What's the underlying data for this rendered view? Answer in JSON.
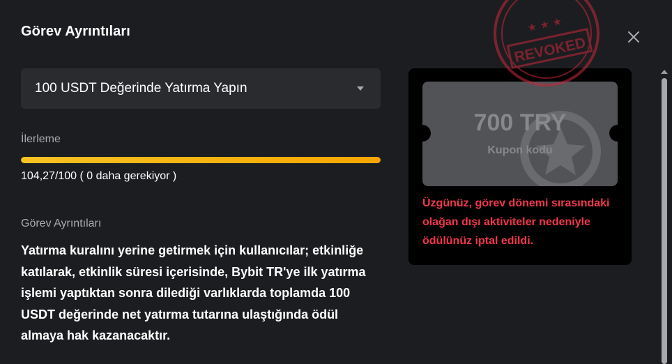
{
  "modal": {
    "title": "Görev Ayrıntıları",
    "close_icon": "close-icon"
  },
  "task_select": {
    "value": "100 USDT Değerinde Yatırma Yapın",
    "icon": "chevron-down-icon"
  },
  "progress": {
    "label": "İlerleme",
    "text": "104,27/100 ( 0 daha gerekiyor )",
    "percent": 100,
    "color": "#f7a600"
  },
  "details": {
    "heading": "Görev Ayrıntıları",
    "body": "Yatırma kuralını yerine getirmek için kullanıcılar; etkinliğe katılarak, etkinlik süresi içerisinde, Bybit TR'ye ilk yatırma işlemi yaptıktan sonra dilediği varlıklarda toplamda 100 USDT değerinde net yatırma tutarına ulaştığında ödül almaya hak kazanacaktır."
  },
  "reward": {
    "amount": "700 TRY",
    "label": "Kupon kodu",
    "watermark_icon": "star-medal-icon",
    "message": "Üzgünüz, görev dönemi sırasındaki olağan dışı aktiviteler nedeniyle ödülünüz iptal edildi.",
    "message_color": "#f2374b"
  },
  "stamp": {
    "text": "REVOKED",
    "color": "#c8283c"
  }
}
